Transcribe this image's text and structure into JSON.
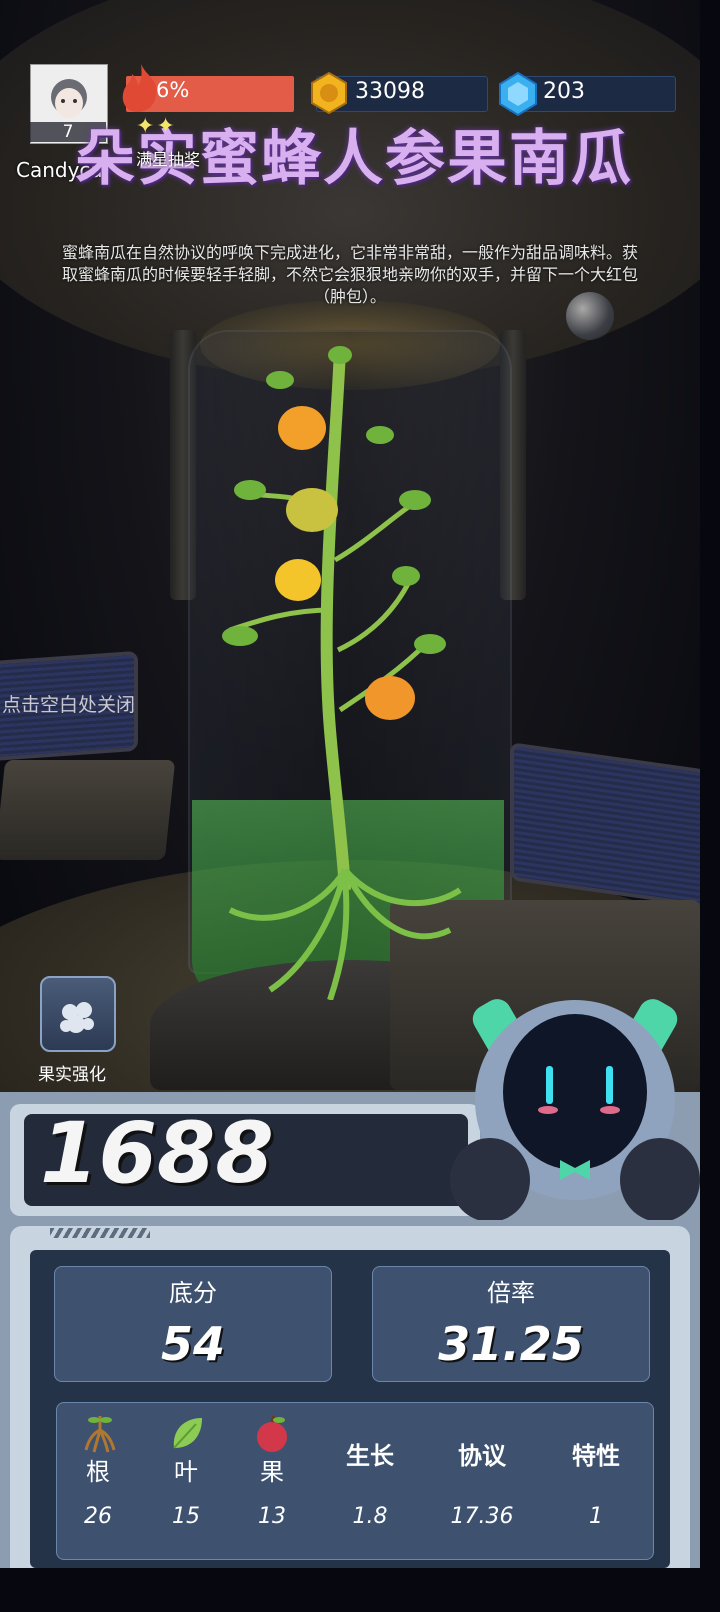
{
  "player": {
    "level": "7",
    "username": "Candycat",
    "energy_percent": "6%",
    "energy_fill": 0.06
  },
  "currency": {
    "gold": "33098",
    "gems": "203"
  },
  "lottery": {
    "stars": "✦✦",
    "label": "满星抽奖"
  },
  "fruit": {
    "title": "朵实蜜蜂人参果南瓜",
    "description": "蜜蜂南瓜在自然协议的呼唤下完成进化，它非常非常甜，一般作为甜品调味料。获取蜜蜂南瓜的时候要轻手轻脚，不然它会狠狠地亲吻你的双手，并留下一个大红包（肿包）。"
  },
  "hints": {
    "close": "点击空白处关闭"
  },
  "buttons": {
    "strengthen": "果实强化"
  },
  "score": {
    "total": "1688",
    "base_label": "底分",
    "base_value": "54",
    "multiplier_label": "倍率",
    "multiplier_value": "31.25"
  },
  "attributes": [
    {
      "name": "根",
      "value": "26",
      "icon": "root-icon"
    },
    {
      "name": "叶",
      "value": "15",
      "icon": "leaf-icon"
    },
    {
      "name": "果",
      "value": "13",
      "icon": "fruit-icon"
    },
    {
      "name": "生长",
      "value": "1.8"
    },
    {
      "name": "协议",
      "value": "17.36"
    },
    {
      "name": "特性",
      "value": "1"
    }
  ],
  "colors": {
    "energy": "#e35c47",
    "title": "#d8b0f0",
    "panel": "#253349",
    "stat_box": "#3e5270"
  }
}
